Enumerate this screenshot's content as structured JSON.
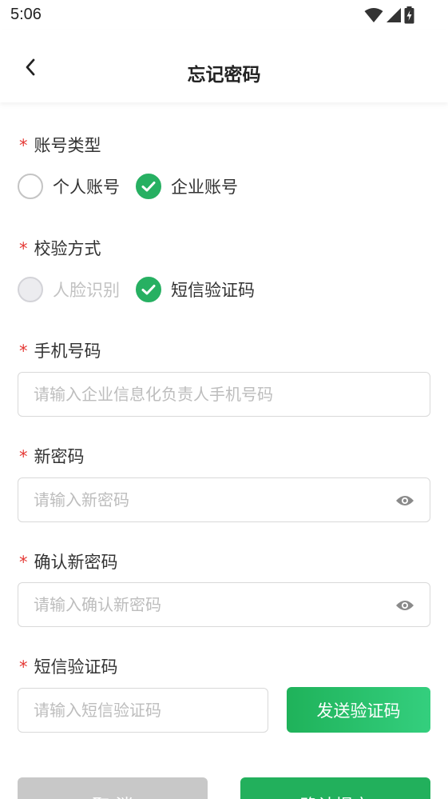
{
  "status_bar": {
    "time": "5:06"
  },
  "header": {
    "title": "忘记密码"
  },
  "form": {
    "account_type": {
      "required_mark": "*",
      "label": "账号类型",
      "options": [
        {
          "label": "个人账号",
          "checked": false
        },
        {
          "label": "企业账号",
          "checked": true
        }
      ]
    },
    "verify_method": {
      "required_mark": "*",
      "label": "校验方式",
      "options": [
        {
          "label": "人脸识别",
          "checked": false,
          "disabled": true
        },
        {
          "label": "短信验证码",
          "checked": true
        }
      ]
    },
    "phone": {
      "required_mark": "*",
      "label": "手机号码",
      "value": "",
      "placeholder": "请输入企业信息化负责人手机号码"
    },
    "new_password": {
      "required_mark": "*",
      "label": "新密码",
      "value": "",
      "placeholder": "请输入新密码"
    },
    "confirm_password": {
      "required_mark": "*",
      "label": "确认新密码",
      "value": "",
      "placeholder": "请输入确认新密码"
    },
    "sms_code": {
      "required_mark": "*",
      "label": "短信验证码",
      "value": "",
      "placeholder": "请输入短信验证码",
      "send_button": "发送验证码"
    }
  },
  "actions": {
    "cancel": "取 消",
    "confirm": "确认提交"
  },
  "colors": {
    "accent": "#22b05c",
    "required": "#e53935",
    "disabled_button": "#c8c8c8"
  }
}
